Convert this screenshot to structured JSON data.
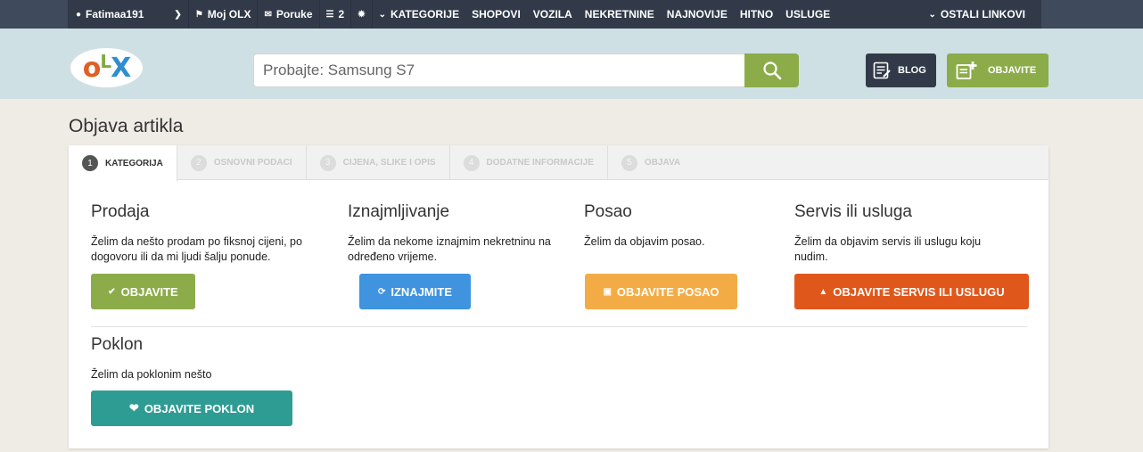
{
  "topnav": {
    "user": "Fatimaa191",
    "moj_olx": "Moj OLX",
    "poruke": "Poruke",
    "count": "2",
    "kategorije": "KATEGORIJE",
    "shopovi": "SHOPOVI",
    "vozila": "VOZILA",
    "nekretnine": "NEKRETNINE",
    "najnovije": "NAJNOVIJE",
    "hitno": "HITNO",
    "usluge": "USLUGE",
    "ostali": "OSTALI LINKOVI"
  },
  "header": {
    "search_placeholder": "Probajte: Samsung S7",
    "blog": "BLOG",
    "objavite": "OBJAVITE"
  },
  "page": {
    "title": "Objava artikla"
  },
  "tabs": [
    {
      "num": "1",
      "label": "KATEGORIJA"
    },
    {
      "num": "2",
      "label": "OSNOVNI PODACI"
    },
    {
      "num": "3",
      "label": "CIJENA, SLIKE I OPIS"
    },
    {
      "num": "4",
      "label": "DODATNE INFORMACIJE"
    },
    {
      "num": "5",
      "label": "OBJAVA"
    }
  ],
  "categories": {
    "prodaja": {
      "title": "Prodaja",
      "desc": "Želim da nešto prodam po fiksnoj cijeni, po dogovoru ili da mi ljudi šalju ponude.",
      "button": "OBJAVITE",
      "color": "#8cac4a"
    },
    "iznajmljivanje": {
      "title": "Iznajmljivanje",
      "desc": "Želim da nekome iznajmim nekretninu na određeno vrijeme.",
      "button": "IZNAJMITE",
      "color": "#3f93df"
    },
    "posao": {
      "title": "Posao",
      "desc": "Želim da objavim posao.",
      "button": "OBJAVITE POSAO",
      "color": "#f3ac45"
    },
    "servis": {
      "title": "Servis ili usluga",
      "desc": "Želim da objavim servis ili uslugu koju nudim.",
      "button": "OBJAVITE SERVIS ILI USLUGU",
      "color": "#e0571c"
    },
    "poklon": {
      "title": "Poklon",
      "desc": "Želim da poklonim nešto",
      "button": "OBJAVITE POKLON",
      "color": "#2f9c94"
    }
  }
}
